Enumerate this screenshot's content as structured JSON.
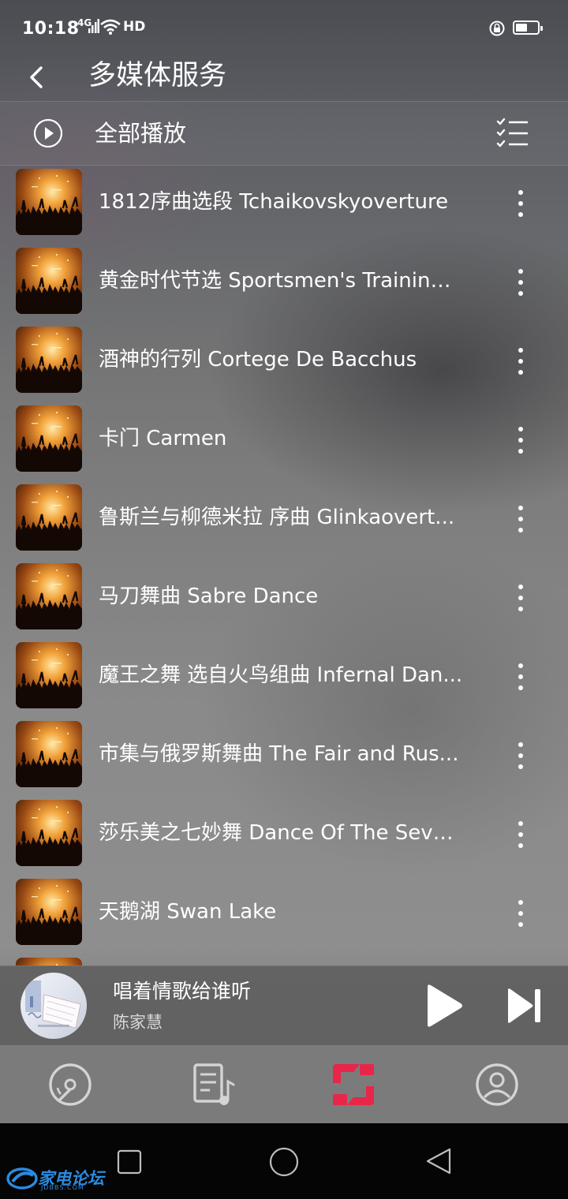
{
  "status_bar": {
    "time": "10:18",
    "network": "4G",
    "hd": "HD"
  },
  "header": {
    "title": "多媒体服务"
  },
  "play_all": {
    "label": "全部播放"
  },
  "songs": [
    {
      "title": "1812序曲选段 Tchaikovskyoverture"
    },
    {
      "title": "黄金时代节选 Sportsmen's Training ..."
    },
    {
      "title": "酒神的行列 Cortege De Bacchus"
    },
    {
      "title": "卡门 Carmen"
    },
    {
      "title": "鲁斯兰与柳德米拉 序曲 Glinkaovert..."
    },
    {
      "title": "马刀舞曲 Sabre Dance"
    },
    {
      "title": "魔王之舞 选自火鸟组曲 Infernal Dan..."
    },
    {
      "title": "市集与俄罗斯舞曲 The Fair and Rus..."
    },
    {
      "title": "莎乐美之七妙舞 Dance Of The Seve..."
    },
    {
      "title": "天鹅湖 Swan Lake"
    }
  ],
  "now_playing": {
    "title": "唱着情歌给谁听",
    "artist": "陈家慧"
  },
  "bottom_tabs": [
    {
      "icon": "disc-icon"
    },
    {
      "icon": "playlist-icon"
    },
    {
      "icon": "sync-icon",
      "active": true
    },
    {
      "icon": "profile-icon"
    }
  ],
  "watermark": {
    "text": "家电论坛",
    "sub": "JDBBS.COM"
  },
  "colors": {
    "accent": "#e8264a",
    "tab_icon": "#d4d4d4"
  }
}
